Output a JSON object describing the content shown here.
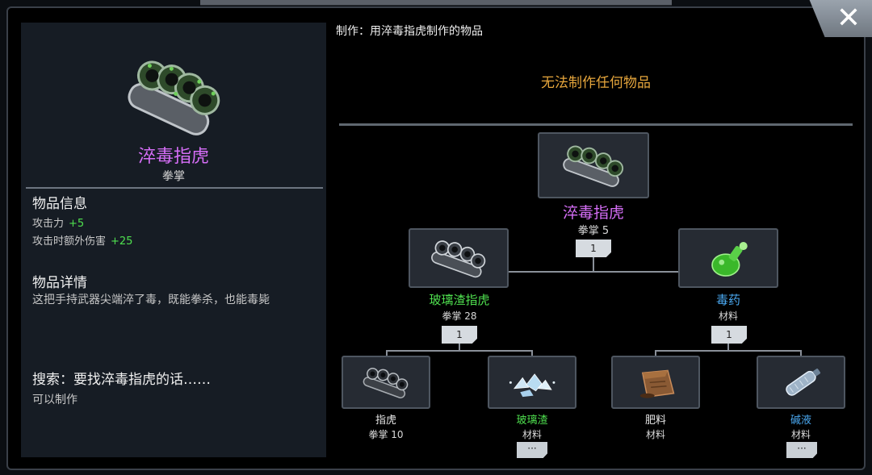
{
  "close_button": {
    "label": "✕"
  },
  "item": {
    "name": "淬毒指虎",
    "type": "拳掌",
    "info_title": "物品信息",
    "stats": [
      {
        "label": "攻击力",
        "value": "+5"
      },
      {
        "label": "攻击时额外伤害",
        "value": "+25"
      }
    ],
    "detail_title": "物品详情",
    "detail_text": "这把手持武器尖端淬了毒，既能拳杀，也能毒毙",
    "search_title": "搜索：要找淬毒指虎的话……",
    "search_result": "可以制作"
  },
  "craft": {
    "title": "制作：用淬毒指虎制作的物品",
    "empty_message": "无法制作任何物品"
  },
  "tree": {
    "root": {
      "name": "淬毒指虎",
      "sub": "拳掌 5",
      "count": "1",
      "icon": "poison-knuckles-icon"
    },
    "left": {
      "name": "玻璃渣指虎",
      "sub": "拳掌 28",
      "count": "1",
      "icon": "glass-knuckles-icon"
    },
    "right": {
      "name": "毒药",
      "sub": "材料",
      "count": "1",
      "icon": "poison-bottle-icon"
    },
    "leaves": [
      {
        "name": "指虎",
        "sub": "拳掌 10",
        "icon": "knuckles-icon",
        "more": ""
      },
      {
        "name": "玻璃渣",
        "sub": "材料",
        "icon": "glass-shards-icon",
        "more": "···"
      },
      {
        "name": "肥料",
        "sub": "材料",
        "icon": "fertilizer-bag-icon",
        "more": ""
      },
      {
        "name": "碱液",
        "sub": "材料",
        "icon": "lye-bottle-icon",
        "more": "···"
      }
    ]
  },
  "colors": {
    "purple": "#d66ef7",
    "green": "#4fe04f",
    "blue": "#4aa8f0",
    "orange": "#e6a63c"
  }
}
